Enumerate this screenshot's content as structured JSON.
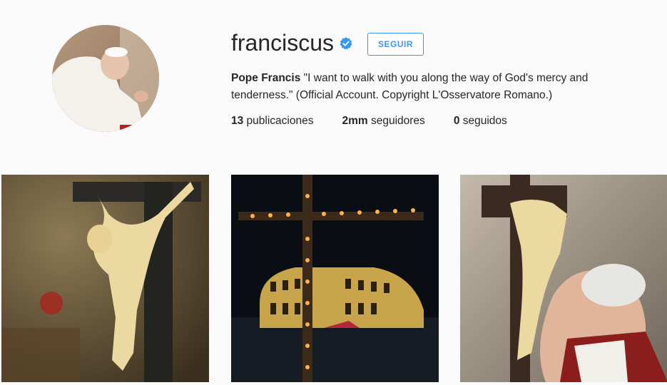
{
  "profile": {
    "username": "franciscus",
    "verified_icon": "verified-badge-icon",
    "follow_label": "SEGUIR",
    "bio_name": "Pope Francis",
    "bio_text": " \"I want to walk with you along the way of God's mercy and tenderness.\" (Official Account. Copyright L'Osservatore Romano.)",
    "stats": [
      {
        "count": "13",
        "label": " publicaciones"
      },
      {
        "count": "2mm",
        "label": " seguidores"
      },
      {
        "count": "0",
        "label": " seguidos"
      }
    ]
  },
  "colors": {
    "accent": "#3897f0",
    "background": "#fafafa",
    "text": "#262626"
  }
}
